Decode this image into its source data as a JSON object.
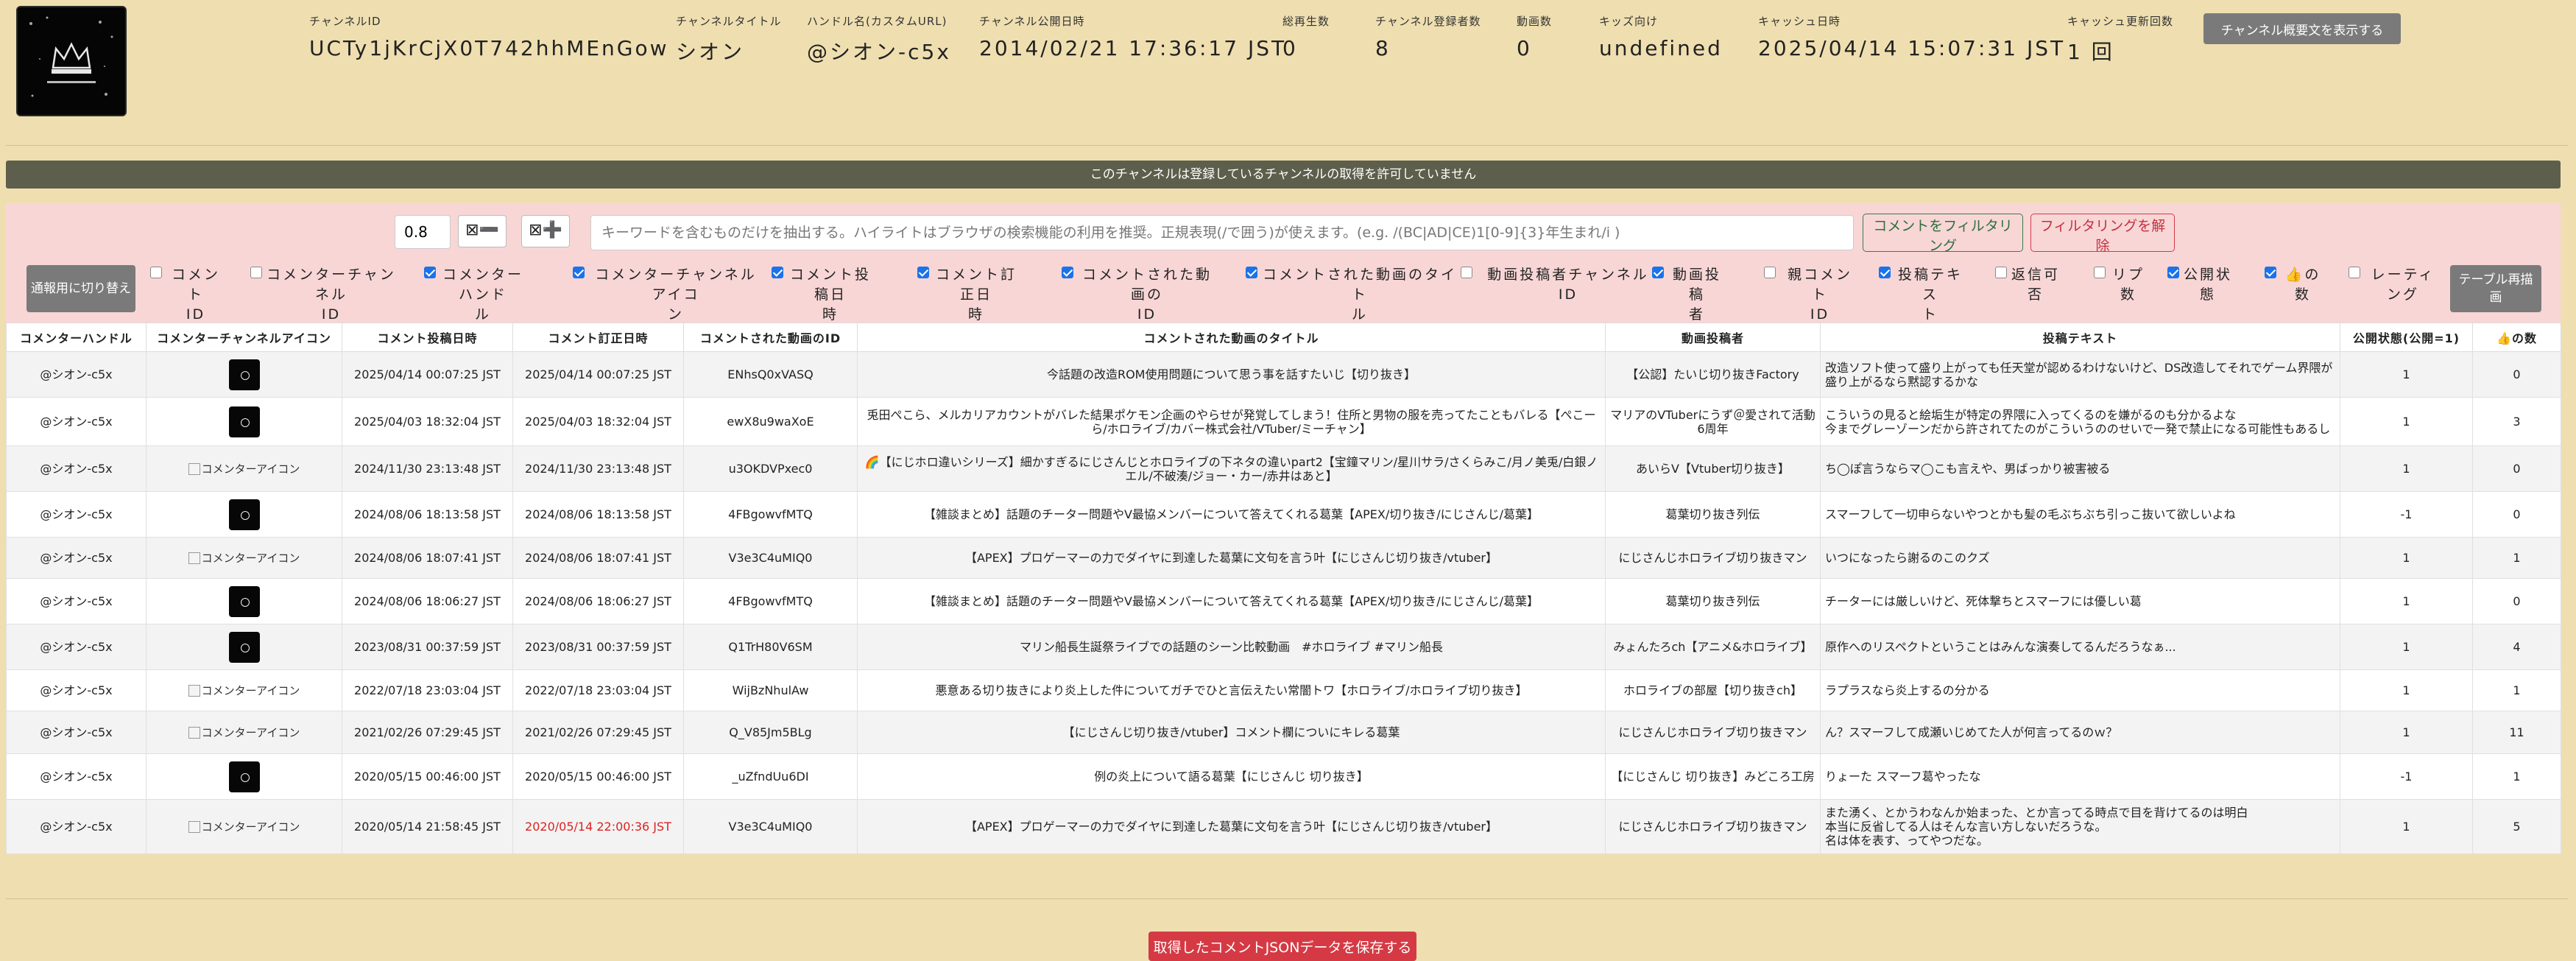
{
  "channel": {
    "fields": [
      {
        "label": "チャンネルID",
        "value": "UCTy1jKrCjX0T742hhMEnGow"
      },
      {
        "label": "チャンネルタイトル",
        "value": "シオン"
      },
      {
        "label": "ハンドル名(カスタムURL)",
        "value": "@シオン-c5x"
      },
      {
        "label": "チャンネル公開日時",
        "value": "2014/02/21 17:36:17 JST"
      },
      {
        "label": "総再生数",
        "value": "0"
      },
      {
        "label": "チャンネル登録者数",
        "value": "8"
      },
      {
        "label": "動画数",
        "value": "0"
      },
      {
        "label": "キッズ向け",
        "value": "undefined"
      },
      {
        "label": "キャッシュ日時",
        "value": "2025/04/14 15:07:31 JST"
      },
      {
        "label": "キャッシュ更新回数",
        "value": "1 回"
      }
    ],
    "show_description_label": "チャンネル概要文を表示する"
  },
  "notice": "このチャンネルは登録しているチャンネルの取得を許可していません",
  "filter": {
    "size_value": "0.8",
    "zoom_out": "⊠➖",
    "zoom_in": "⊠➕",
    "placeholder": "キーワードを含むものだけを抽出する。ハイライトはブラウザの検索機能の利用を推奨。正規表現(/で囲う)が使えます。(e.g. /(BC|AD|CE)1[0-9]{3}年生まれ/i )",
    "filter_label": "コメントをフィルタリング",
    "unfilter_label": "フィルタリングを解除",
    "switch_label": "通報用に切り替え",
    "redraw_label": "テーブル再描画",
    "columns": [
      {
        "l1": "コメント",
        "l2": "ID",
        "on": false
      },
      {
        "l1": "コメンターチャンネル",
        "l2": "ID",
        "on": false
      },
      {
        "l1": "コメンターハンド",
        "l2": "ル",
        "on": true
      },
      {
        "l1": "コメンターチャンネルアイコ",
        "l2": "ン",
        "on": true
      },
      {
        "l1": "コメント投稿日",
        "l2": "時",
        "on": true
      },
      {
        "l1": "コメント訂正日",
        "l2": "時",
        "on": true
      },
      {
        "l1": "コメントされた動画の",
        "l2": "ID",
        "on": true
      },
      {
        "l1": "コメントされた動画のタイト",
        "l2": "ル",
        "on": true
      },
      {
        "l1": "動画投稿者チャンネル",
        "l2": "ID",
        "on": false
      },
      {
        "l1": "動画投稿",
        "l2": "者",
        "on": true
      },
      {
        "l1": "親コメント",
        "l2": "ID",
        "on": false
      },
      {
        "l1": "投稿テキス",
        "l2": "ト",
        "on": true
      },
      {
        "l1": "返信可",
        "l2": "否",
        "on": false
      },
      {
        "l1": "リプ",
        "l2": "数",
        "on": false
      },
      {
        "l1": "公開状",
        "l2": "態",
        "on": true
      },
      {
        "l1": "👍の",
        "l2": "数",
        "on": true
      },
      {
        "l1": "レーティ",
        "l2": "ング",
        "on": false
      }
    ]
  },
  "table": {
    "headers": [
      "コメンターハンドル",
      "コメンターチャンネルアイコン",
      "コメント投稿日時",
      "コメント訂正日時",
      "コメントされた動画のID",
      "コメントされた動画のタイトル",
      "動画投稿者",
      "投稿テキスト",
      "公開状態(公開=1)",
      "👍の数"
    ],
    "broken_alt": "コメンターアイコン",
    "rows": [
      {
        "handle": "@シオン-c5x",
        "icon": "img",
        "posted": "2025/04/14 00:07:25 JST",
        "edited": "2025/04/14 00:07:25 JST",
        "edited_red": false,
        "vid": "ENhsQ0xVASQ",
        "title": "今話題の改造ROM使用問題について思う事を話すたいじ【切り抜き】",
        "author": "【公認】たいじ切り抜きFactory",
        "text": "改造ソフト使って盛り上がっても任天堂が認めるわけないけど、DS改造してそれでゲーム界隈が盛り上がるなら黙認するかな",
        "status": "1",
        "likes": "0"
      },
      {
        "handle": "@シオン-c5x",
        "icon": "img",
        "posted": "2025/04/03 18:32:04 JST",
        "edited": "2025/04/03 18:32:04 JST",
        "edited_red": false,
        "vid": "ewX8u9waXoE",
        "title": "兎田ぺこら、メルカリアカウントがバレた結果ポケモン企画のやらせが発覚してしまう！住所と男物の服を売ってたこともバレる【ぺこーら/ホロライブ/カバー株式会社/VTuber/ミーチャン】",
        "author": "マリアのVTuberにうず＠愛されて活動6周年",
        "text": "こういうの見ると絵垢生が特定の界隈に入ってくるのを嫌がるのも分かるよな\n今までグレーゾーンだから許されてたのがこういうののせいで一発で禁止になる可能性もあるし",
        "status": "1",
        "likes": "3"
      },
      {
        "handle": "@シオン-c5x",
        "icon": "broken",
        "posted": "2024/11/30 23:13:48 JST",
        "edited": "2024/11/30 23:13:48 JST",
        "edited_red": false,
        "vid": "u3OKDVPxec0",
        "title": "🌈【にじホロ違いシリーズ】細かすぎるにじさんじとホロライブの下ネタの違いpart2【宝鐘マリン/星川サラ/さくらみこ/月ノ美兎/白銀ノエル/不破湊/ジョー・カー/赤井はあと】",
        "author": "あいらV【Vtuber切り抜き】",
        "text": "ち◯ぽ言うならマ◯こも言えや、男ばっかり被害被る",
        "status": "1",
        "likes": "0"
      },
      {
        "handle": "@シオン-c5x",
        "icon": "img",
        "posted": "2024/08/06 18:13:58 JST",
        "edited": "2024/08/06 18:13:58 JST",
        "edited_red": false,
        "vid": "4FBgowvfMTQ",
        "title": "【雑談まとめ】話題のチーター問題やV最協メンバーについて答えてくれる葛葉【APEX/切り抜き/にじさんじ/葛葉】",
        "author": "葛葉切り抜き列伝",
        "text": "スマーフして一切申らないやつとかも髪の毛ぶちぶち引っこ抜いて欲しいよね",
        "status": "-1",
        "likes": "0"
      },
      {
        "handle": "@シオン-c5x",
        "icon": "broken",
        "posted": "2024/08/06 18:07:41 JST",
        "edited": "2024/08/06 18:07:41 JST",
        "edited_red": false,
        "vid": "V3e3C4uMIQ0",
        "title": "【APEX】プロゲーマーの力でダイヤに到達した葛葉に文句を言う叶【にじさんじ切り抜き/vtuber】",
        "author": "にじさんじホロライブ切り抜きマン",
        "text": "いつになったら謝るのこのクズ",
        "status": "1",
        "likes": "1"
      },
      {
        "handle": "@シオン-c5x",
        "icon": "img",
        "posted": "2024/08/06 18:06:27 JST",
        "edited": "2024/08/06 18:06:27 JST",
        "edited_red": false,
        "vid": "4FBgowvfMTQ",
        "title": "【雑談まとめ】話題のチーター問題やV最協メンバーについて答えてくれる葛葉【APEX/切り抜き/にじさんじ/葛葉】",
        "author": "葛葉切り抜き列伝",
        "text": "チーターには厳しいけど、死体撃ちとスマーフには優しい葛",
        "status": "1",
        "likes": "0"
      },
      {
        "handle": "@シオン-c5x",
        "icon": "img",
        "posted": "2023/08/31 00:37:59 JST",
        "edited": "2023/08/31 00:37:59 JST",
        "edited_red": false,
        "vid": "Q1TrH80V6SM",
        "title": "マリン船長生誕祭ライブでの話題のシーン比較動画　#ホロライブ #マリン船長",
        "author": "みょんたろch【アニメ&ホロライブ】",
        "text": "原作へのリスペクトということはみんな演奏してるんだろうなぁ...",
        "status": "1",
        "likes": "4"
      },
      {
        "handle": "@シオン-c5x",
        "icon": "broken",
        "posted": "2022/07/18 23:03:04 JST",
        "edited": "2022/07/18 23:03:04 JST",
        "edited_red": false,
        "vid": "WijBzNhulAw",
        "title": "悪意ある切り抜きにより炎上した件についてガチでひと言伝えたい常闇トワ【ホロライブ/ホロライブ切り抜き】",
        "author": "ホロライブの部屋【切り抜きch】",
        "text": "ラプラスなら炎上するの分かる",
        "status": "1",
        "likes": "1"
      },
      {
        "handle": "@シオン-c5x",
        "icon": "broken",
        "posted": "2021/02/26 07:29:45 JST",
        "edited": "2021/02/26 07:29:45 JST",
        "edited_red": false,
        "vid": "Q_V85Jm5BLg",
        "title": "【にじさんじ切り抜き/vtuber】コメント欄についにキレる葛葉",
        "author": "にじさんじホロライブ切り抜きマン",
        "text": "ん？スマーフして成瀬いじめてた人が何言ってるのｗ？",
        "status": "1",
        "likes": "11"
      },
      {
        "handle": "@シオン-c5x",
        "icon": "img",
        "posted": "2020/05/15 00:46:00 JST",
        "edited": "2020/05/15 00:46:00 JST",
        "edited_red": false,
        "vid": "_uZfndUu6DI",
        "title": "例の炎上について語る葛葉【にじさんじ 切り抜き】",
        "author": "【にじさんじ 切り抜き】みどころ工房",
        "text": "りょーた スマーフ葛やったな",
        "status": "-1",
        "likes": "1"
      },
      {
        "handle": "@シオン-c5x",
        "icon": "broken",
        "posted": "2020/05/14 21:58:45 JST",
        "edited": "2020/05/14 22:00:36 JST",
        "edited_red": true,
        "vid": "V3e3C4uMIQ0",
        "title": "【APEX】プロゲーマーの力でダイヤに到達した葛葉に文句を言う叶【にじさんじ切り抜き/vtuber】",
        "author": "にじさんじホロライブ切り抜きマン",
        "text": "また湧く、とかうわなんか始まった、とか言ってる時点で目を背けてるのは明白\n本当に反省してる人はそんな言い方しないだろうな。\n名は体を表す、ってやつだな。",
        "status": "1",
        "likes": "5"
      }
    ]
  },
  "save_label": "取得したコメントJSONデータを保存する"
}
